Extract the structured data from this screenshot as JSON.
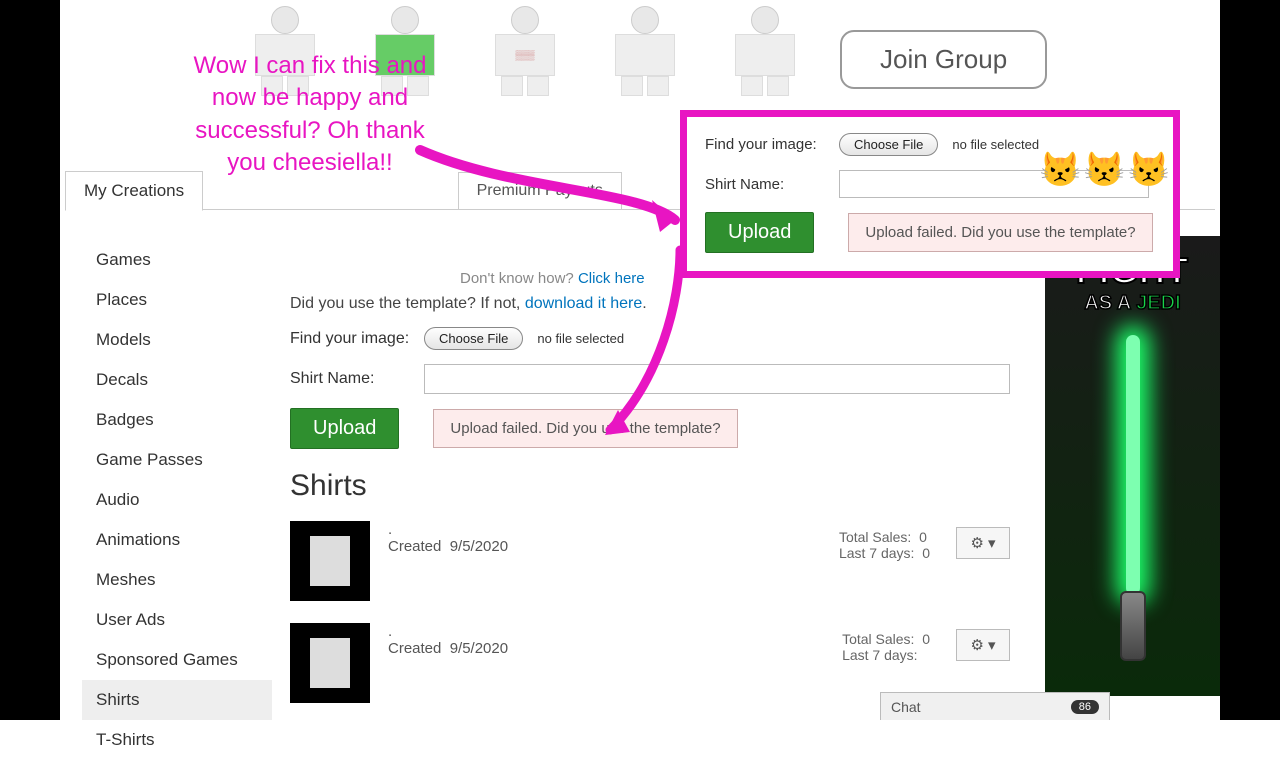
{
  "header": {
    "join_group_label": "Join Group"
  },
  "tabs": {
    "primary": "My Creations",
    "secondary": "Premium Payouts"
  },
  "sidebar": {
    "items": [
      "Games",
      "Places",
      "Models",
      "Decals",
      "Badges",
      "Game Passes",
      "Audio",
      "Animations",
      "Meshes",
      "User Ads",
      "Sponsored Games",
      "Shirts",
      "T-Shirts"
    ],
    "selected_index": 11
  },
  "help": {
    "prefix": "Don't know how? ",
    "link": "Click here",
    "template_prefix": "Did you use the template? If not, ",
    "template_link": "download it here"
  },
  "form": {
    "find_image_label": "Find your image:",
    "choose_file_btn": "Choose File",
    "file_status": "no file selected",
    "shirt_name_label": "Shirt Name:",
    "shirt_name_value": "",
    "upload_btn": "Upload",
    "error_msg": "Upload failed. Did you use the template?"
  },
  "section_heading": "Shirts",
  "shirts": [
    {
      "name": ".",
      "created_label": "Created",
      "created": "9/5/2020",
      "total_sales_label": "Total Sales:",
      "total_sales": "0",
      "last7_label": "Last 7 days:",
      "last7": "0"
    },
    {
      "name": ".",
      "created_label": "Created",
      "created": "9/5/2020",
      "total_sales_label": "Total Sales:",
      "total_sales": "0",
      "last7_label": "Last 7 days:",
      "last7": ""
    }
  ],
  "ad": {
    "line1": "FIGHT",
    "line2a": "AS A ",
    "line2b": "JEDI"
  },
  "annotation": {
    "text": "Wow I can fix this and now be happy and successful? Oh thank you cheesiella!!",
    "emojis": "😾😾😾"
  },
  "chat": {
    "label": "Chat",
    "badge": "86"
  }
}
